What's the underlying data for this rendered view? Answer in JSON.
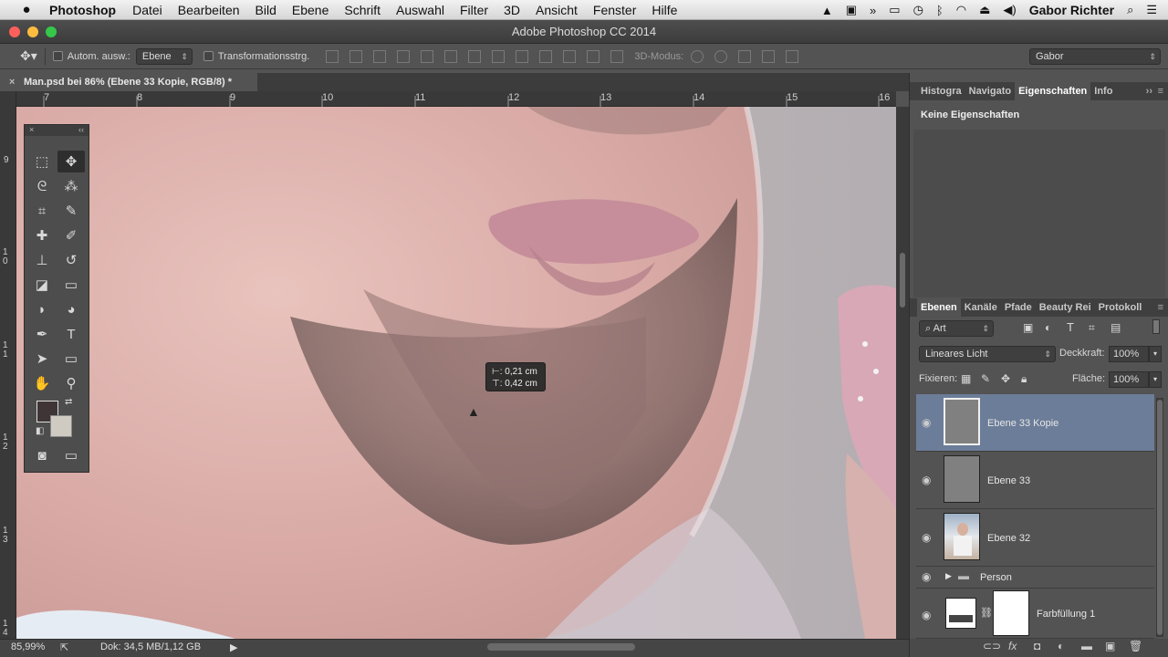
{
  "menubar": {
    "apple": "",
    "app": "Photoshop",
    "items": [
      "Datei",
      "Bearbeiten",
      "Bild",
      "Ebene",
      "Schrift",
      "Auswahl",
      "Filter",
      "3D",
      "Ansicht",
      "Fenster",
      "Hilfe"
    ],
    "user": "Gabor Richter"
  },
  "window": {
    "title": "Adobe Photoshop CC 2014"
  },
  "options": {
    "auto_select_label": "Autom. ausw.:",
    "auto_select_value": "Ebene",
    "transform_label": "Transformationsstrg.",
    "mode_label": "3D-Modus:",
    "workspace": "Gabor"
  },
  "document": {
    "tab_title": "Man.psd bei 86% (Ebene 33 Kopie, RGB/8) *"
  },
  "rulers": {
    "horizontal": [
      "7",
      "8",
      "9",
      "10",
      "11",
      "12",
      "13",
      "14",
      "15",
      "16"
    ],
    "vertical": [
      "9",
      "1 0",
      "1 1",
      "1 2",
      "1 3",
      "1 4"
    ]
  },
  "tooltip": {
    "line1": "⊢: 0,21 cm",
    "line2": "⊤: 0,42 cm"
  },
  "status": {
    "zoom": "85,99%",
    "doc": "Dok: 34,5 MB/1,12 GB"
  },
  "panels": {
    "top_tabs": [
      "Histogra",
      "Navigato",
      "Eigenschaften",
      "Info"
    ],
    "properties_text": "Keine Eigenschaften",
    "layer_tabs": [
      "Ebenen",
      "Kanäle",
      "Pfade",
      "Beauty Rei",
      "Protokoll"
    ],
    "filter_kind": "Art",
    "blend_mode": "Lineares Licht",
    "opacity_label": "Deckkraft:",
    "opacity_value": "100%",
    "lock_label": "Fixieren:",
    "fill_label": "Fläche:",
    "fill_value": "100%"
  },
  "layers": [
    {
      "name": "Ebene 33 Kopie",
      "selected": true
    },
    {
      "name": "Ebene 33",
      "selected": false
    },
    {
      "name": "Ebene 32",
      "selected": false
    },
    {
      "name": "Person",
      "selected": false
    },
    {
      "name": "Farbfüllung 1",
      "selected": false
    }
  ],
  "colors": {
    "selected_layer": "#6c7d99",
    "foreground": "#3f3536",
    "background": "#cfcbc2"
  }
}
